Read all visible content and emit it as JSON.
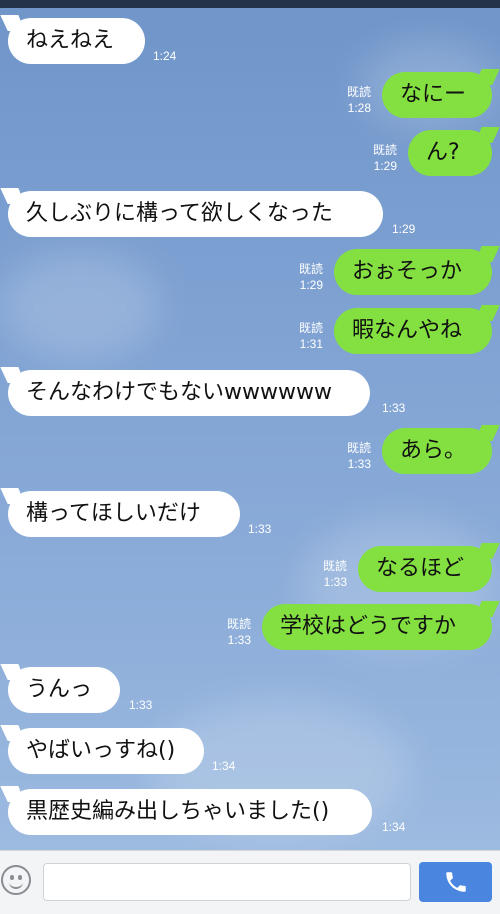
{
  "messages": [
    {
      "side": "in",
      "text": "ねえねえ",
      "time": "1:24"
    },
    {
      "side": "out",
      "text": "なにー",
      "read": "既読",
      "time": "1:28"
    },
    {
      "side": "out",
      "text": "ん?",
      "read": "既読",
      "time": "1:29"
    },
    {
      "side": "in",
      "text": "久しぶりに構って欲しくなった",
      "time": "1:29"
    },
    {
      "side": "out",
      "text": "おぉそっか",
      "read": "既読",
      "time": "1:29"
    },
    {
      "side": "out",
      "text": "暇なんやね",
      "read": "既読",
      "time": "1:31"
    },
    {
      "side": "in",
      "text": "そんなわけでもないwwwwww",
      "time": "1:33"
    },
    {
      "side": "out",
      "text": "あら。",
      "read": "既読",
      "time": "1:33"
    },
    {
      "side": "in",
      "text": "構ってほしいだけ",
      "time": "1:33"
    },
    {
      "side": "out",
      "text": "なるほど",
      "read": "既読",
      "time": "1:33"
    },
    {
      "side": "out",
      "text": "学校はどうですか",
      "read": "既読",
      "time": "1:33"
    },
    {
      "side": "in",
      "text": "うんっ",
      "time": "1:33"
    },
    {
      "side": "in",
      "text": "やばいっすね()",
      "time": "1:34"
    },
    {
      "side": "in",
      "text": "黒歴史編み出しちゃいました()",
      "time": "1:34"
    }
  ],
  "input": {
    "value": "",
    "placeholder": ""
  },
  "icons": {
    "emoji": "emoji-icon",
    "call": "phone-icon"
  },
  "colors": {
    "outgoing": "#84e041",
    "incoming": "#ffffff",
    "call_button": "#4a86e0"
  }
}
